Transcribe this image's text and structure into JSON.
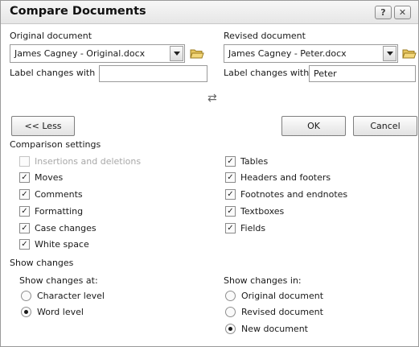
{
  "dialog": {
    "title": "Compare Documents",
    "help_icon_glyph": "?",
    "close_icon_glyph": "✕"
  },
  "original": {
    "label": "Original document",
    "selected": "James Cagney - Original.docx",
    "label_changes_label": "Label changes with",
    "label_changes_value": ""
  },
  "revised": {
    "label": "Revised document",
    "selected": "James Cagney - Peter.docx",
    "label_changes_label": "Label changes with",
    "label_changes_value": "Peter"
  },
  "swap_icon_glyph": "⇄",
  "buttons": {
    "less": "<< Less",
    "ok": "OK",
    "cancel": "Cancel"
  },
  "comparison_settings": {
    "heading": "Comparison settings",
    "left": [
      {
        "label": "Insertions and deletions",
        "checked": true,
        "disabled": true
      },
      {
        "label": "Moves",
        "checked": true,
        "disabled": false
      },
      {
        "label": "Comments",
        "checked": true,
        "disabled": false
      },
      {
        "label": "Formatting",
        "checked": true,
        "disabled": false
      },
      {
        "label": "Case changes",
        "checked": true,
        "disabled": false
      },
      {
        "label": "White space",
        "checked": true,
        "disabled": false
      }
    ],
    "right": [
      {
        "label": "Tables",
        "checked": true,
        "disabled": false
      },
      {
        "label": "Headers and footers",
        "checked": true,
        "disabled": false
      },
      {
        "label": "Footnotes and endnotes",
        "checked": true,
        "disabled": false
      },
      {
        "label": "Textboxes",
        "checked": true,
        "disabled": false
      },
      {
        "label": "Fields",
        "checked": true,
        "disabled": false
      }
    ]
  },
  "show_changes": {
    "heading": "Show changes",
    "at_label": "Show changes at:",
    "at_options": [
      {
        "label": "Character level",
        "selected": false
      },
      {
        "label": "Word level",
        "selected": true
      }
    ],
    "in_label": "Show changes in:",
    "in_options": [
      {
        "label": "Original document",
        "selected": false
      },
      {
        "label": "Revised document",
        "selected": false
      },
      {
        "label": "New document",
        "selected": true
      }
    ]
  },
  "colors": {
    "titlebar": "#e9e9e9",
    "folder_icon": "#d8b248"
  }
}
